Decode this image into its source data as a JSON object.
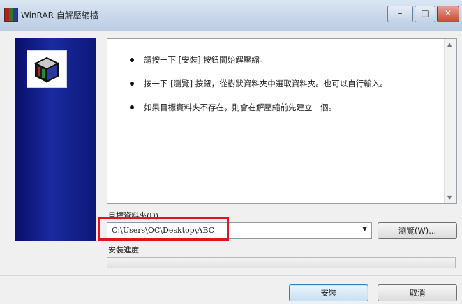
{
  "window": {
    "title": "WinRAR 自解壓縮檔",
    "minimize_glyph": "–",
    "maximize_glyph": "□",
    "close_glyph": "✕"
  },
  "messages": [
    "請按一下 [安裝] 按鈕開始解壓縮。",
    "按一下 [瀏覽] 按鈕，從樹狀資料夾中選取資料夾。也可以自行輸入。",
    "如果目標資料夾不存在，則會在解壓縮前先建立一個。"
  ],
  "destination": {
    "label": "目標資料夾(D)",
    "value": "C:\\Users\\OC\\Desktop\\ABC",
    "dropdown_glyph": "▼"
  },
  "browse_button": "瀏覽(W)...",
  "progress": {
    "label": "安裝進度",
    "value": 0
  },
  "buttons": {
    "install": "安裝",
    "cancel": "取消"
  },
  "colors": {
    "highlight": "#e0141b",
    "sidebar": "#0a0f6a"
  },
  "icons": {
    "app": "winrar-books-icon",
    "logo": "winrar-books-icon"
  }
}
